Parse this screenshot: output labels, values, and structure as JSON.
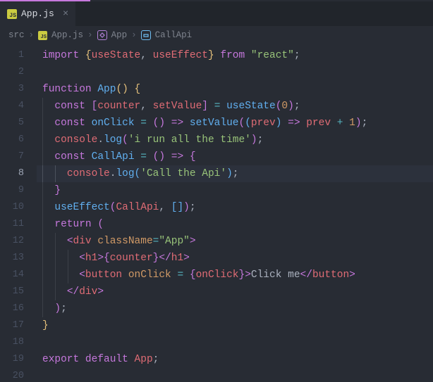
{
  "tab": {
    "filename": "App.js",
    "badge": "JS"
  },
  "breadcrumb": {
    "seg0": "src",
    "seg1_badge": "JS",
    "seg1": "App.js",
    "seg2": "App",
    "seg3": "CallApi"
  },
  "gutter": {
    "1": "1",
    "2": "2",
    "3": "3",
    "4": "4",
    "5": "5",
    "6": "6",
    "7": "7",
    "8": "8",
    "9": "9",
    "10": "10",
    "11": "11",
    "12": "12",
    "13": "13",
    "14": "14",
    "15": "15",
    "16": "16",
    "17": "17",
    "18": "18",
    "19": "19",
    "20": "20"
  },
  "active_line": 8,
  "t": {
    "import": "import",
    "from": "from",
    "react_str": "\"react\"",
    "open_brace": "{",
    "close_brace": "}",
    "useState": "useState",
    "useEffect": "useEffect",
    "function": "function",
    "App": "App",
    "paren_open": "(",
    "paren_close": ")",
    "const": "const",
    "counter": "counter",
    "setValue": "setValue",
    "eq": "=",
    "zero": "0",
    "semi": ";",
    "comma": ", ",
    "onClick": "onClick",
    "arrow": "=>",
    "prev": "prev",
    "plus": "+",
    "one": "1",
    "console": "console",
    "dot": ".",
    "log": "log",
    "str_run": "'i run all the time'",
    "CallApi": "CallApi",
    "str_call": "'Call the Api'",
    "open_sq": "[",
    "close_sq": "]",
    "return": "return",
    "lt": "<",
    "gt": ">",
    "slash": "/",
    "div": "div",
    "className": "className",
    "app_str": "\"App\"",
    "h1": "h1",
    "button": "button",
    "click_me": "Click me",
    "export": "export",
    "default": "default",
    "sp": " "
  }
}
